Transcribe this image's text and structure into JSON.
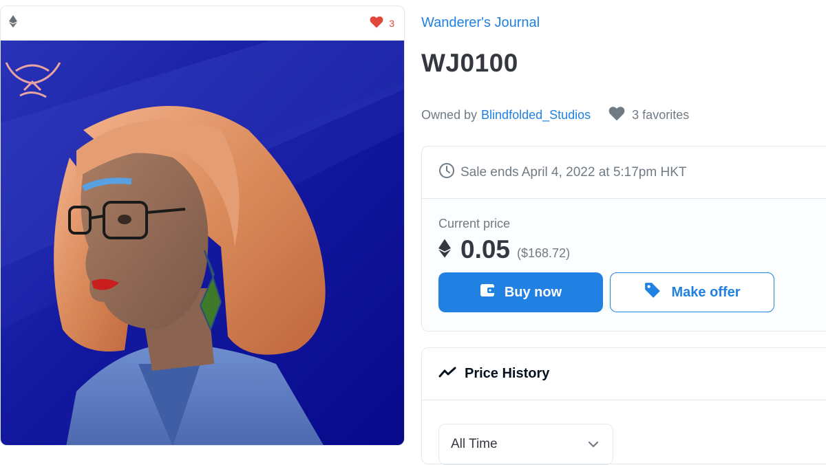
{
  "card": {
    "chain_icon": "ethereum-icon",
    "favorite_icon": "heart-icon",
    "favorite_count": "3"
  },
  "item": {
    "collection": "Wanderer's Journal",
    "name": "WJ0100",
    "owned_by_label": "Owned by",
    "owner": "Blindfolded_Studios",
    "favorites_label": "3 favorites"
  },
  "sale": {
    "ends_text": "Sale ends April 4, 2022 at 5:17pm HKT",
    "current_price_label": "Current price",
    "price": "0.05",
    "price_usd": "($168.72)",
    "buy_label": "Buy now",
    "offer_label": "Make offer"
  },
  "history": {
    "title": "Price History",
    "range_selected": "All Time"
  },
  "colors": {
    "accent": "#2081e2",
    "heart": "#e2473b",
    "art_background": "#0a0f8f"
  }
}
